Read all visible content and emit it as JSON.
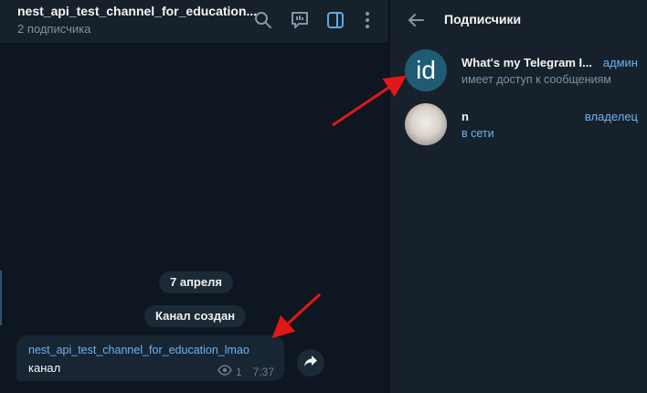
{
  "chat": {
    "title": "nest_api_test_channel_for_education...",
    "subtitle": "2 подписчика",
    "icons": [
      "search-icon",
      "poll-icon",
      "sidebar-icon",
      "more-icon"
    ],
    "date_pill": "7 апреля",
    "service_message": "Канал создан",
    "message": {
      "channel_name": "nest_api_test_channel_for_education_lmao",
      "text": "канал",
      "views": "1",
      "time": "7:37"
    }
  },
  "panel": {
    "title": "Подписчики",
    "members": [
      {
        "avatar_text": "id",
        "name": "What's my Telegram I...",
        "role": "админ",
        "status": "имеет доступ к сообщениям"
      },
      {
        "avatar_text": "",
        "name": "n",
        "role": "владелец",
        "status": "в сети"
      }
    ]
  },
  "colors": {
    "accent": "#6ab3f3",
    "sidebar_active": "#5fa8e8",
    "annotation_arrow": "#e01818"
  }
}
